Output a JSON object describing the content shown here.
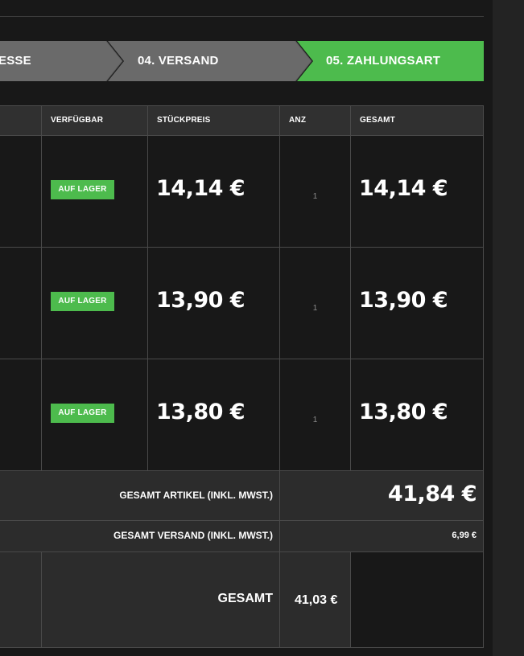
{
  "colors": {
    "active_step": "#4dbb4d",
    "inactive_step": "#6a6a6a",
    "badge_green": "#4dbb4d",
    "background": "#181818"
  },
  "steps": [
    {
      "label": "ESSE"
    },
    {
      "label": "04. VERSAND"
    },
    {
      "label": "05. ZAHLUNGSART"
    }
  ],
  "table": {
    "headers": {
      "available": "VERFÜGBAR",
      "unit_price": "STÜCKPREIS",
      "qty": "ANZ",
      "total": "GESAMT"
    },
    "rows": [
      {
        "availability": "AUF LAGER",
        "unit_price": "14,14 €",
        "qty": "1",
        "total": "14,14 €"
      },
      {
        "availability": "AUF LAGER",
        "unit_price": "13,90 €",
        "qty": "1",
        "total": "13,90 €"
      },
      {
        "availability": "AUF LAGER",
        "unit_price": "13,80 €",
        "qty": "1",
        "total": "13,80 €"
      }
    ],
    "summary": {
      "articles_label": "GESAMT ARTIKEL (INKL. MWST.)",
      "articles_value": "41,84 €",
      "shipping_label": "GESAMT VERSAND (INKL. MWST.)",
      "shipping_value": "6,99 €",
      "grand_label": "GESAMT",
      "grand_value": "41,03 €"
    }
  }
}
